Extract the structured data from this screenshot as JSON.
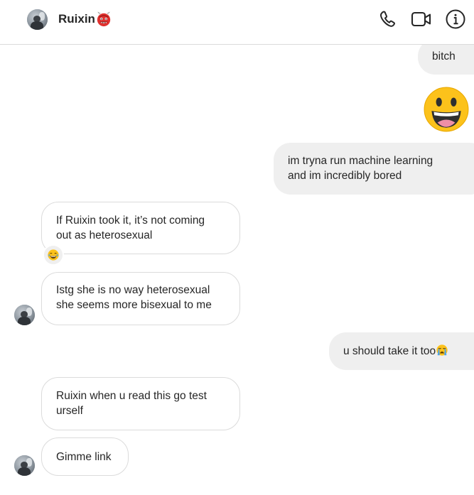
{
  "header": {
    "title": "Ruixin",
    "title_emoji": "ogre-emoji",
    "icons": [
      "phone-icon",
      "video-camera-icon",
      "info-icon"
    ]
  },
  "messages": [
    {
      "side": "outgoing",
      "lines": [
        "bitch"
      ]
    },
    {
      "side": "outgoing",
      "emoji": "grinning-face"
    },
    {
      "side": "outgoing",
      "lines": [
        "im tryna run machine learning",
        "and im incredibly bored"
      ]
    },
    {
      "side": "incoming",
      "lines": [
        "If Ruixin took it, it’s not coming",
        "out as heterosexual"
      ],
      "reaction": "tears-of-joy"
    },
    {
      "side": "incoming",
      "lines": [
        "Istg she is no way heterosexual",
        "she seems more bisexual to me"
      ]
    },
    {
      "side": "outgoing",
      "lines": [
        "u should take it too"
      ],
      "trailing_emoji": "loudly-crying-face"
    },
    {
      "side": "incoming",
      "lines": [
        "Ruixin when u read this go test",
        "urself"
      ]
    },
    {
      "side": "incoming",
      "lines": [
        "Gimme link"
      ]
    }
  ],
  "colors": {
    "outgoing_bubble": "#efefef",
    "incoming_border": "#dbdbdb",
    "text": "#262626",
    "emoji_yellow": "#fcc21b"
  }
}
